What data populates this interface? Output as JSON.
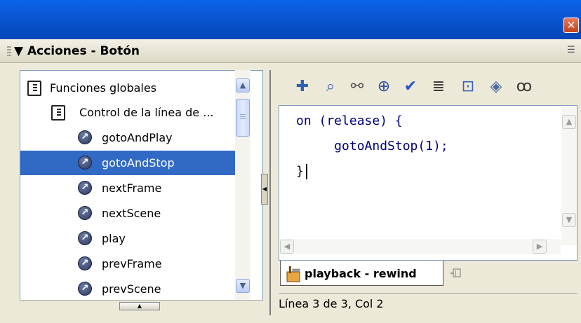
{
  "window": {
    "close_glyph": "✕"
  },
  "panel": {
    "title": "▼ Acciones - Botón",
    "options_icon": "menu-options-icon"
  },
  "tree": {
    "items": [
      {
        "label": "Funciones globales",
        "icon": "book-icon",
        "level": 0
      },
      {
        "label": "Control de la línea de ...",
        "icon": "book-icon",
        "level": 1
      },
      {
        "label": "gotoAndPlay",
        "icon": "function-icon",
        "level": 2
      },
      {
        "label": "gotoAndStop",
        "icon": "function-icon",
        "level": 2,
        "selected": true
      },
      {
        "label": "nextFrame",
        "icon": "function-icon",
        "level": 2
      },
      {
        "label": "nextScene",
        "icon": "function-icon",
        "level": 2
      },
      {
        "label": "play",
        "icon": "function-icon",
        "level": 2
      },
      {
        "label": "prevFrame",
        "icon": "function-icon",
        "level": 2
      },
      {
        "label": "prevScene",
        "icon": "function-icon",
        "level": 2
      }
    ]
  },
  "toolbar": {
    "icons": [
      "add-statement-icon",
      "find-icon",
      "replace-icon",
      "insert-target-path-icon",
      "check-syntax-icon",
      "auto-format-icon",
      "code-hint-icon",
      "debug-options-icon",
      "script-assist-icon"
    ]
  },
  "editor": {
    "lines": [
      "on (release) {",
      "     gotoAndStop(1);",
      "}"
    ]
  },
  "tab": {
    "label": "playback - rewind"
  },
  "status": {
    "text": "Línea 3 de 3, Col 2"
  },
  "colors": {
    "title_bar": "#0a57d6",
    "selection": "#316ac5",
    "code_text": "#00007f"
  }
}
